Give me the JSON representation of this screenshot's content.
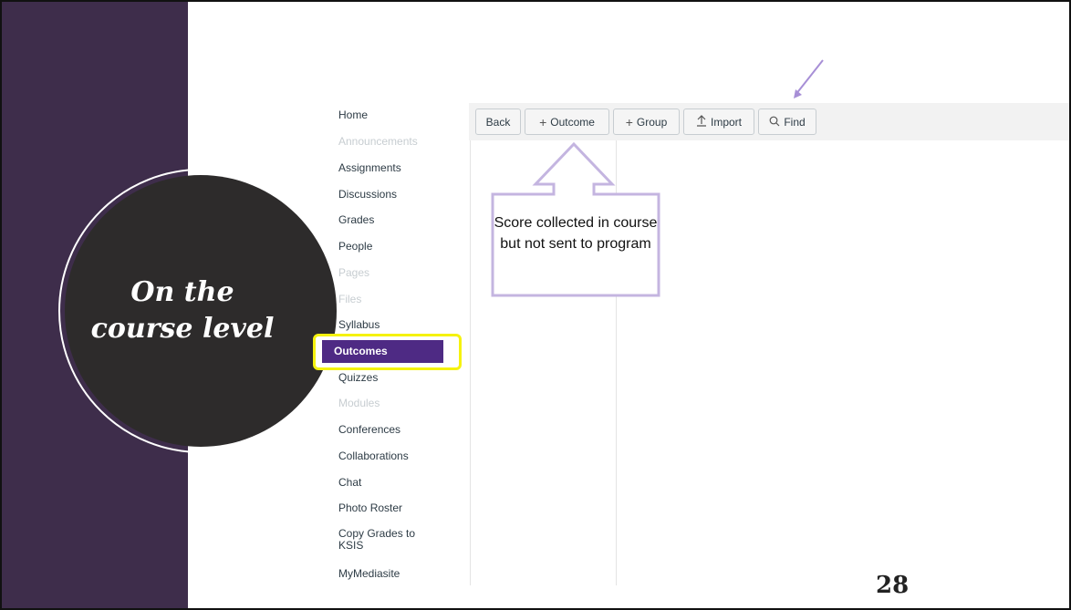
{
  "slide": {
    "title_line1": "On the",
    "title_line2": "course level",
    "page_number": "28"
  },
  "menu": {
    "items": [
      {
        "label": "Home",
        "disabled": false
      },
      {
        "label": "Announcements",
        "disabled": true
      },
      {
        "label": "Assignments",
        "disabled": false
      },
      {
        "label": "Discussions",
        "disabled": false
      },
      {
        "label": "Grades",
        "disabled": false
      },
      {
        "label": "People",
        "disabled": false
      },
      {
        "label": "Pages",
        "disabled": true
      },
      {
        "label": "Files",
        "disabled": true
      },
      {
        "label": "Syllabus",
        "disabled": false
      },
      {
        "label": "Outcomes",
        "active": true
      },
      {
        "label": "Quizzes",
        "disabled": false
      },
      {
        "label": "Modules",
        "disabled": true
      },
      {
        "label": "Conferences",
        "disabled": false
      },
      {
        "label": "Collaborations",
        "disabled": false
      },
      {
        "label": "Chat",
        "disabled": false
      },
      {
        "label": "Photo Roster",
        "disabled": false
      },
      {
        "label": "Copy Grades to KSIS",
        "disabled": false
      },
      {
        "label": "MyMediasite",
        "disabled": false
      }
    ]
  },
  "toolbar": {
    "back_label": "Back",
    "outcome_label": "Outcome",
    "group_label": "Group",
    "import_label": "Import",
    "find_label": "Find"
  },
  "callout": {
    "text": "Score collected in course but not sent to program"
  },
  "colors": {
    "band": "#3e2d4b",
    "circle": "#2d2b2b",
    "active_nav": "#4e2a84",
    "highlight": "#f5f20f",
    "callout_outline": "#c4b5e0"
  }
}
